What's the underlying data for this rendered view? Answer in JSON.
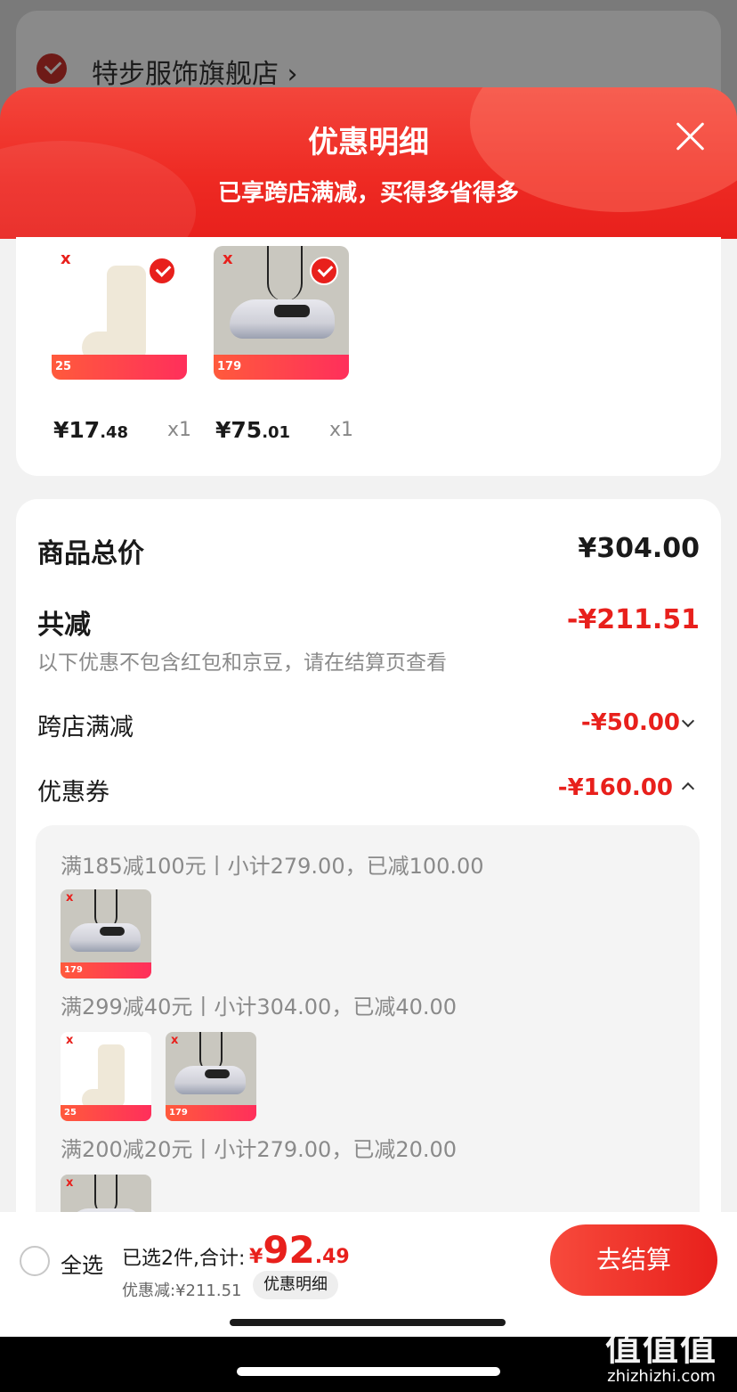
{
  "store": {
    "name": "特步服饰旗舰店 ›"
  },
  "sheet": {
    "title": "优惠明细",
    "subtitle": "已享跨店满减，买得多省得多"
  },
  "products": [
    {
      "price_int": "¥17",
      "price_dec": ".48",
      "qty": "x1",
      "promo_num": "25",
      "brand": "x",
      "selected": true
    },
    {
      "price_int": "¥75",
      "price_dec": ".01",
      "qty": "x1",
      "promo_num": "179",
      "brand": "x",
      "selected": true
    }
  ],
  "summary": {
    "total_label": "商品总价",
    "total_value": "¥304.00",
    "reduce_label": "共减",
    "reduce_value": "-¥211.51",
    "note": "以下优惠不包含红包和京豆，请在结算页查看",
    "cross_store_label": "跨店满减",
    "cross_store_value": "-¥50.00",
    "coupon_label": "优惠券",
    "coupon_value": "-¥160.00"
  },
  "coupons": [
    {
      "text": "满185减100元丨小计279.00，已减100.00"
    },
    {
      "text": "满299减40元丨小计304.00，已减40.00"
    },
    {
      "text": "满200减20元丨小计279.00，已减20.00"
    }
  ],
  "bottom": {
    "select_all": "全选",
    "selected_text": "已选2件,合计:",
    "total_currency": "¥",
    "total_int": "92",
    "total_dec": ".49",
    "discount_text": "优惠减:¥211.51",
    "detail_label": "优惠明细",
    "checkout_label": "去结算"
  },
  "watermark": {
    "logo": "值值值",
    "url": "zhizhizhi.com"
  },
  "colors": {
    "accent": "#e8201c",
    "background": "#f2f2f2"
  },
  "icons": [
    "check-icon",
    "chevron-right-icon",
    "close-icon",
    "chevron-down-icon",
    "chevron-up-icon",
    "radio-icon"
  ]
}
